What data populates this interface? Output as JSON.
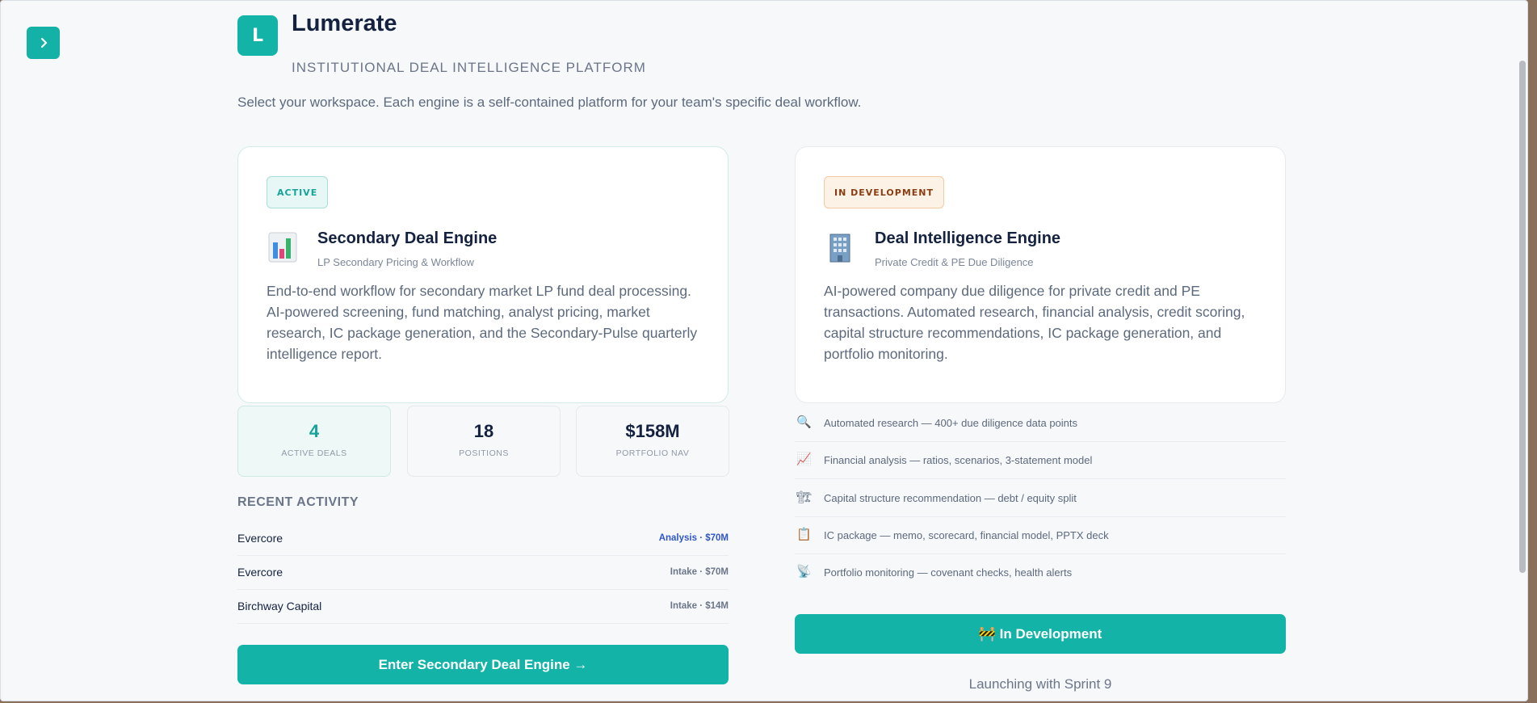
{
  "app": {
    "logo_letter": "L",
    "name": "Lumerate",
    "tagline": "INSTITUTIONAL DEAL INTELLIGENCE PLATFORM",
    "intro": "Select your workspace. Each engine is a self-contained platform for your team's specific deal workflow."
  },
  "colors": {
    "accent": "#13b3a8",
    "title": "#142240",
    "muted": "#6b7689",
    "dev_badge_bg": "#fdf2e6",
    "dev_badge_text": "#8a3d12"
  },
  "secondary": {
    "badge": "ACTIVE",
    "icon": "bar-chart-icon",
    "title": "Secondary Deal Engine",
    "subtitle": "LP Secondary Pricing & Workflow",
    "description": "End-to-end workflow for secondary market LP fund deal processing. AI-powered screening, fund matching, analyst pricing, market research, IC package generation, and the Secondary-Pulse quarterly intelligence report.",
    "stats": [
      {
        "value": "4",
        "label": "ACTIVE DEALS"
      },
      {
        "value": "18",
        "label": "POSITIONS"
      },
      {
        "value": "$158M",
        "label": "PORTFOLIO NAV"
      }
    ],
    "recent_heading": "RECENT ACTIVITY",
    "activity": [
      {
        "name": "Evercore",
        "meta": "Analysis · $70M"
      },
      {
        "name": "Evercore",
        "meta": "Intake · $70M"
      },
      {
        "name": "Birchway Capital",
        "meta": "Intake · $14M"
      }
    ],
    "enter_button": "Enter Secondary Deal Engine →"
  },
  "intelligence": {
    "badge": "IN DEVELOPMENT",
    "icon": "office-building-icon",
    "title": "Deal Intelligence Engine",
    "subtitle": "Private Credit & PE Due Diligence",
    "description": "AI-powered company due diligence for private credit and PE transactions. Automated research, financial analysis, credit scoring, capital structure recommendations, IC package generation, and portfolio monitoring.",
    "features": [
      {
        "icon": "magnifier-icon",
        "text": "Automated research — 400+ due diligence data points"
      },
      {
        "icon": "trend-chart-icon",
        "text": "Financial analysis — ratios, scenarios, 3-statement model"
      },
      {
        "icon": "crane-icon",
        "text": "Capital structure recommendation — debt / equity split"
      },
      {
        "icon": "clipboard-icon",
        "text": "IC package — memo, scorecard, financial model, PPTX deck"
      },
      {
        "icon": "satellite-icon",
        "text": "Portfolio monitoring — covenant checks, health alerts"
      }
    ],
    "dev_button": "🚧 In Development",
    "launch_note": "Launching with Sprint 9"
  }
}
